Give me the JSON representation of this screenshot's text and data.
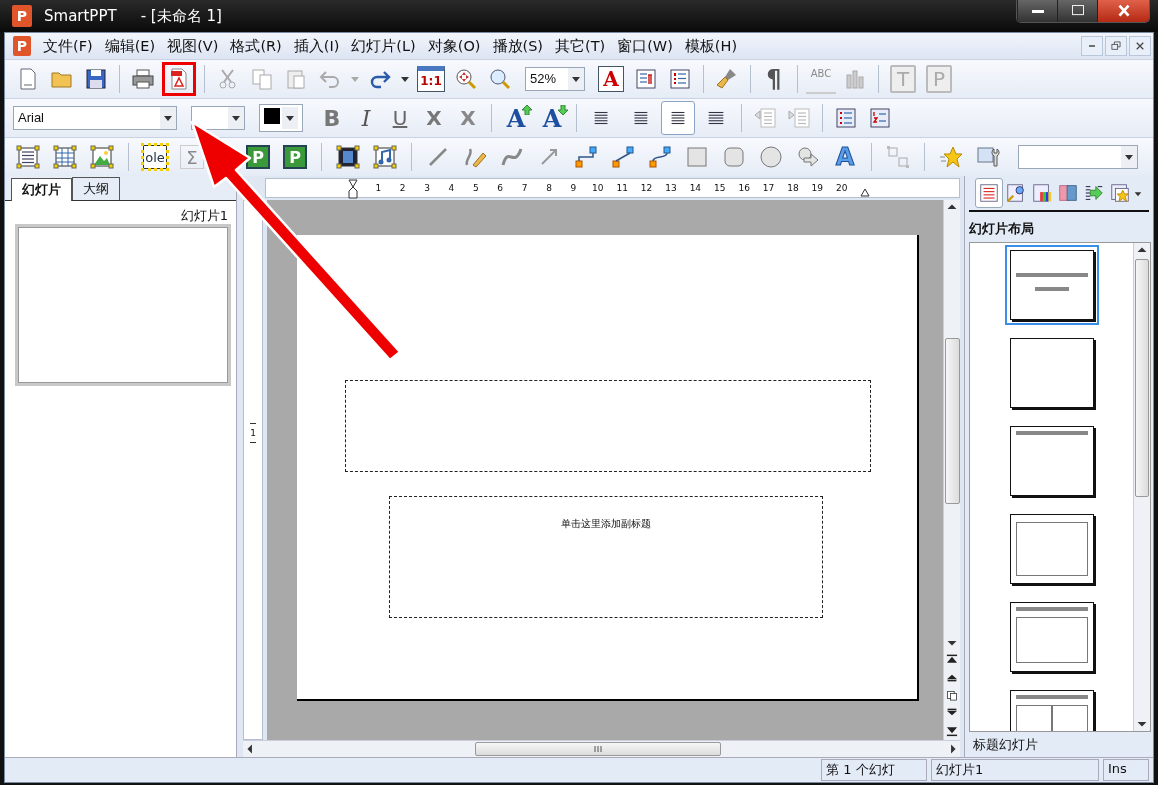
{
  "window": {
    "icon": "P",
    "title": "SmartPPT",
    "document": "- [未命名 1]"
  },
  "menu_bar": {
    "icon": "P",
    "items": [
      {
        "label": "文件(F)"
      },
      {
        "label": "编辑(E)"
      },
      {
        "label": "视图(V)"
      },
      {
        "label": "格式(R)"
      },
      {
        "label": "插入(I)"
      },
      {
        "label": "幻灯片(L)"
      },
      {
        "label": "对象(O)"
      },
      {
        "label": "播放(S)"
      },
      {
        "label": "其它(T)"
      },
      {
        "label": "窗口(W)"
      },
      {
        "label": "模板(H)"
      }
    ]
  },
  "toolbar_1": {
    "glyph_buttons": [
      {
        "label": "1:1",
        "disabled": false
      },
      {
        "label": "A",
        "disabled": false
      },
      {
        "label": "¶",
        "disabled": false
      },
      {
        "label": "ABC",
        "disabled": true
      },
      {
        "label": "T",
        "disabled": true
      },
      {
        "label": "P",
        "disabled": true
      }
    ],
    "zoom": "52%"
  },
  "toolbar_2": {
    "font": "Arial",
    "format_buttons": [
      {
        "label": "B"
      },
      {
        "label": "I"
      },
      {
        "label": "U"
      },
      {
        "label": "X"
      },
      {
        "label": "X"
      }
    ],
    "font_size_buttons": [
      {
        "label": "A"
      },
      {
        "label": "A"
      }
    ],
    "alignment_buttons": [
      {
        "selected": false
      },
      {
        "selected": false
      },
      {
        "selected": true
      },
      {
        "selected": false
      }
    ]
  },
  "toolbar_3": {
    "glyph_buttons": [
      {
        "label": "ole",
        "disabled": false
      },
      {
        "label": "Σ",
        "disabled": true
      },
      {
        "label": "P",
        "disabled": false
      },
      {
        "label": "P",
        "disabled": false
      },
      {
        "label": "A",
        "disabled": false
      }
    ]
  },
  "slides_panel": {
    "tabs": [
      {
        "label": "幻灯片",
        "selected": true
      },
      {
        "label": "大纲",
        "selected": false
      }
    ],
    "thumbnails": [
      {
        "label": "幻灯片1"
      }
    ]
  },
  "ruler": {
    "horizontal": [
      "1",
      "2",
      "3",
      "4",
      "5",
      "6",
      "7",
      "8",
      "9",
      "10",
      "11",
      "12",
      "13",
      "14",
      "15",
      "16",
      "17",
      "18",
      "19",
      "20"
    ],
    "vertical": [
      "1"
    ]
  },
  "slide": {
    "subtitle_placeholder": "单击这里添加副标题"
  },
  "layout_panel": {
    "title": "幻灯片布局",
    "layouts": [
      {
        "kind": "title",
        "selected": true
      },
      {
        "kind": "blank",
        "selected": false
      },
      {
        "kind": "title-only",
        "selected": false
      },
      {
        "kind": "content",
        "selected": false
      },
      {
        "kind": "title-content",
        "selected": false
      },
      {
        "kind": "two-column",
        "selected": false
      }
    ],
    "caption": "标题幻灯片"
  },
  "status_bar": [
    "第 1 个幻灯",
    "幻灯片1",
    "Ins"
  ]
}
